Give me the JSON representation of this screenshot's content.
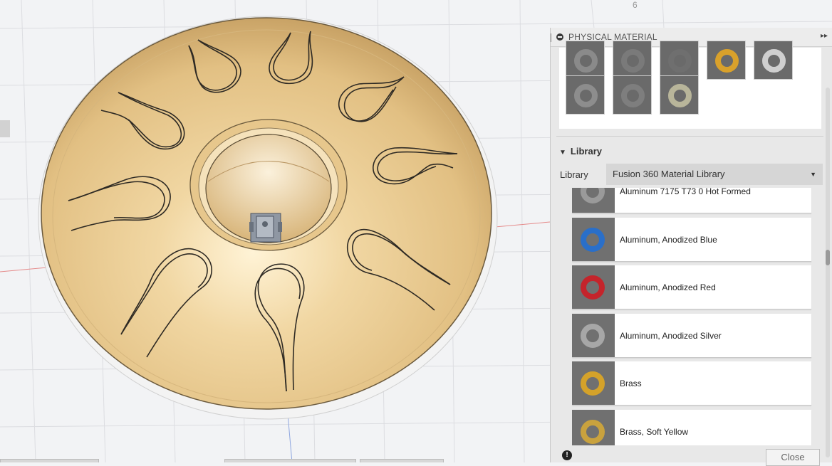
{
  "canvas": {
    "axis_label": "6",
    "body_color": "#e9c98f",
    "accent_orange": "#e6a23c"
  },
  "panel": {
    "title": "PHYSICAL MATERIAL",
    "in_use_thumbs": [
      {
        "material": "steel",
        "color": "#8a8a8a"
      },
      {
        "material": "steel",
        "color": "#7a7a7a"
      },
      {
        "material": "steel",
        "color": "#6f6f6f"
      },
      {
        "material": "gold",
        "color": "#d9a12b"
      },
      {
        "material": "chrome",
        "color": "#cfcfcf"
      },
      {
        "material": "steel",
        "color": "#8d8d8d"
      },
      {
        "material": "steel",
        "color": "#7e7e7e"
      },
      {
        "material": "nickel",
        "color": "#b8b59a"
      }
    ],
    "library_heading": "Library",
    "library_label": "Library",
    "library_selected": "Fusion 360 Material Library",
    "materials": [
      {
        "name": "Aluminum 7175 T73 0 Hot Formed",
        "ring_color": "#9a9a9a"
      },
      {
        "name": "Aluminum, Anodized Blue",
        "ring_color": "#2a6fc9"
      },
      {
        "name": "Aluminum, Anodized Red",
        "ring_color": "#c4242b"
      },
      {
        "name": "Aluminum, Anodized Silver",
        "ring_color": "#a7a7a7"
      },
      {
        "name": "Brass",
        "ring_color": "#d4a22a"
      },
      {
        "name": "Brass, Soft Yellow",
        "ring_color": "#c9a23e"
      }
    ],
    "close_label": "Close",
    "info_glyph": "!"
  }
}
